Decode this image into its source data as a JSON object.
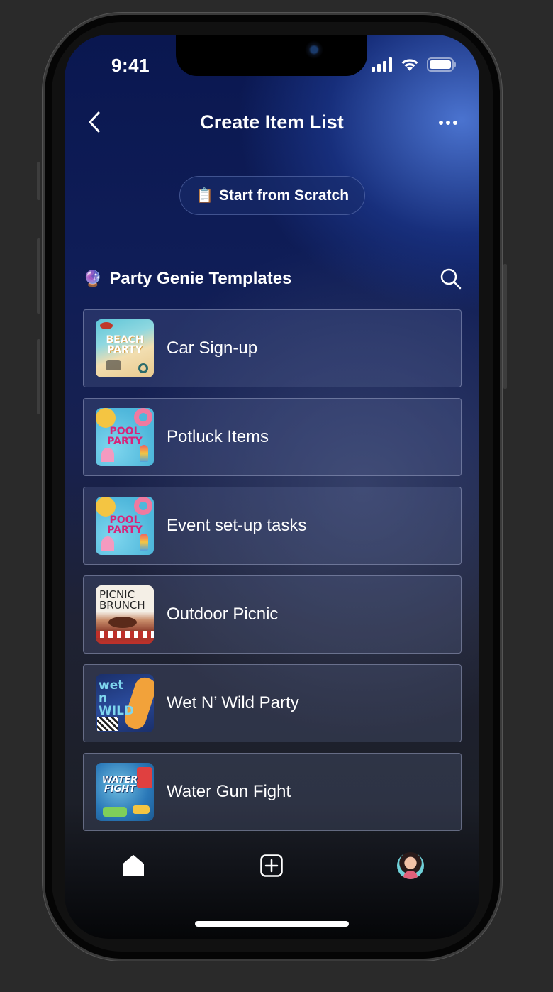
{
  "status_bar": {
    "time": "9:41"
  },
  "header": {
    "title": "Create Item List"
  },
  "scratch_button": {
    "emoji": "📋",
    "label": "Start from Scratch"
  },
  "templates": {
    "heading_icon": "🔮",
    "heading": "Party Genie Templates",
    "items": [
      {
        "label": "Car Sign-up",
        "thumb_text": "BEACH PARTY",
        "thumb_theme": "beach"
      },
      {
        "label": "Potluck Items",
        "thumb_text": "POOL PARTY",
        "thumb_theme": "pool"
      },
      {
        "label": "Event set-up tasks",
        "thumb_text": "POOL PARTY",
        "thumb_theme": "pool"
      },
      {
        "label": "Outdoor Picnic",
        "thumb_text": "PICNIC BRUNCH",
        "thumb_theme": "picnic"
      },
      {
        "label": "Wet N’ Wild Party",
        "thumb_text": "wet n WILD",
        "thumb_theme": "wild"
      },
      {
        "label": "Water Gun Fight",
        "thumb_text": "WATER FIGHT",
        "thumb_theme": "water"
      }
    ]
  },
  "tab_bar": {
    "items": [
      {
        "name": "home",
        "icon": "home-icon"
      },
      {
        "name": "add",
        "icon": "plus-square-icon"
      },
      {
        "name": "profile",
        "icon": "avatar"
      }
    ]
  },
  "colors": {
    "accent_blue": "#4e78d6",
    "background_dark": "#0a1750",
    "card_border": "#aab4d2"
  }
}
